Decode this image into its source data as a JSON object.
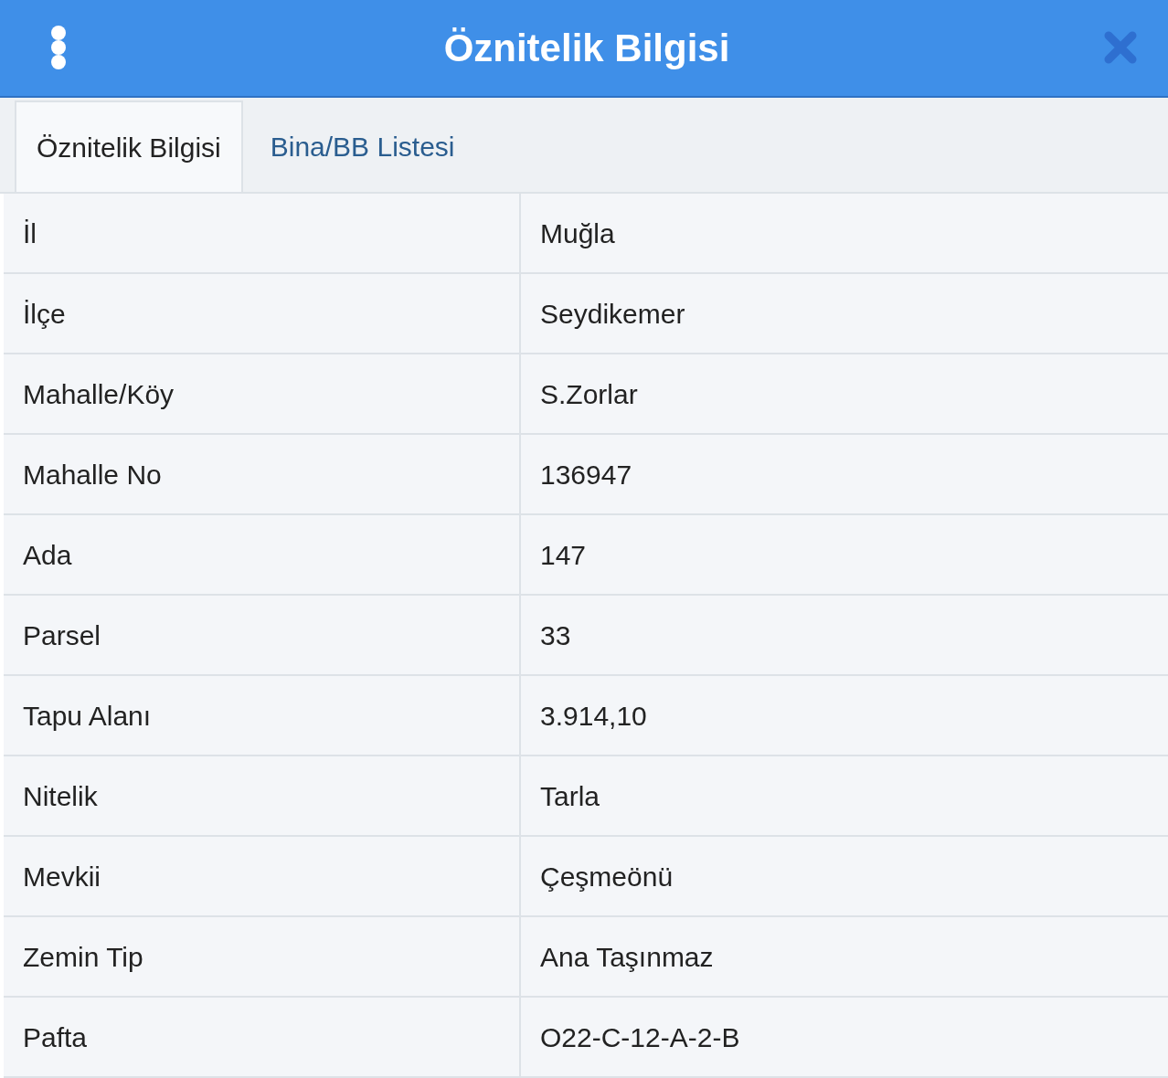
{
  "header": {
    "title": "Öznitelik Bilgisi"
  },
  "tabs": [
    {
      "label": "Öznitelik Bilgisi",
      "selected": true
    },
    {
      "label": "Bina/BB Listesi",
      "selected": false
    }
  ],
  "rows": [
    {
      "label": "İl",
      "value": "Muğla"
    },
    {
      "label": "İlçe",
      "value": "Seydikemer"
    },
    {
      "label": "Mahalle/Köy",
      "value": "S.Zorlar"
    },
    {
      "label": "Mahalle No",
      "value": "136947"
    },
    {
      "label": "Ada",
      "value": "147"
    },
    {
      "label": "Parsel",
      "value": "33"
    },
    {
      "label": "Tapu Alanı",
      "value": "3.914,10"
    },
    {
      "label": "Nitelik",
      "value": "Tarla"
    },
    {
      "label": "Mevkii",
      "value": "Çeşmeönü"
    },
    {
      "label": "Zemin Tip",
      "value": "Ana Taşınmaz"
    },
    {
      "label": "Pafta",
      "value": "O22-C-12-A-2-B"
    }
  ]
}
